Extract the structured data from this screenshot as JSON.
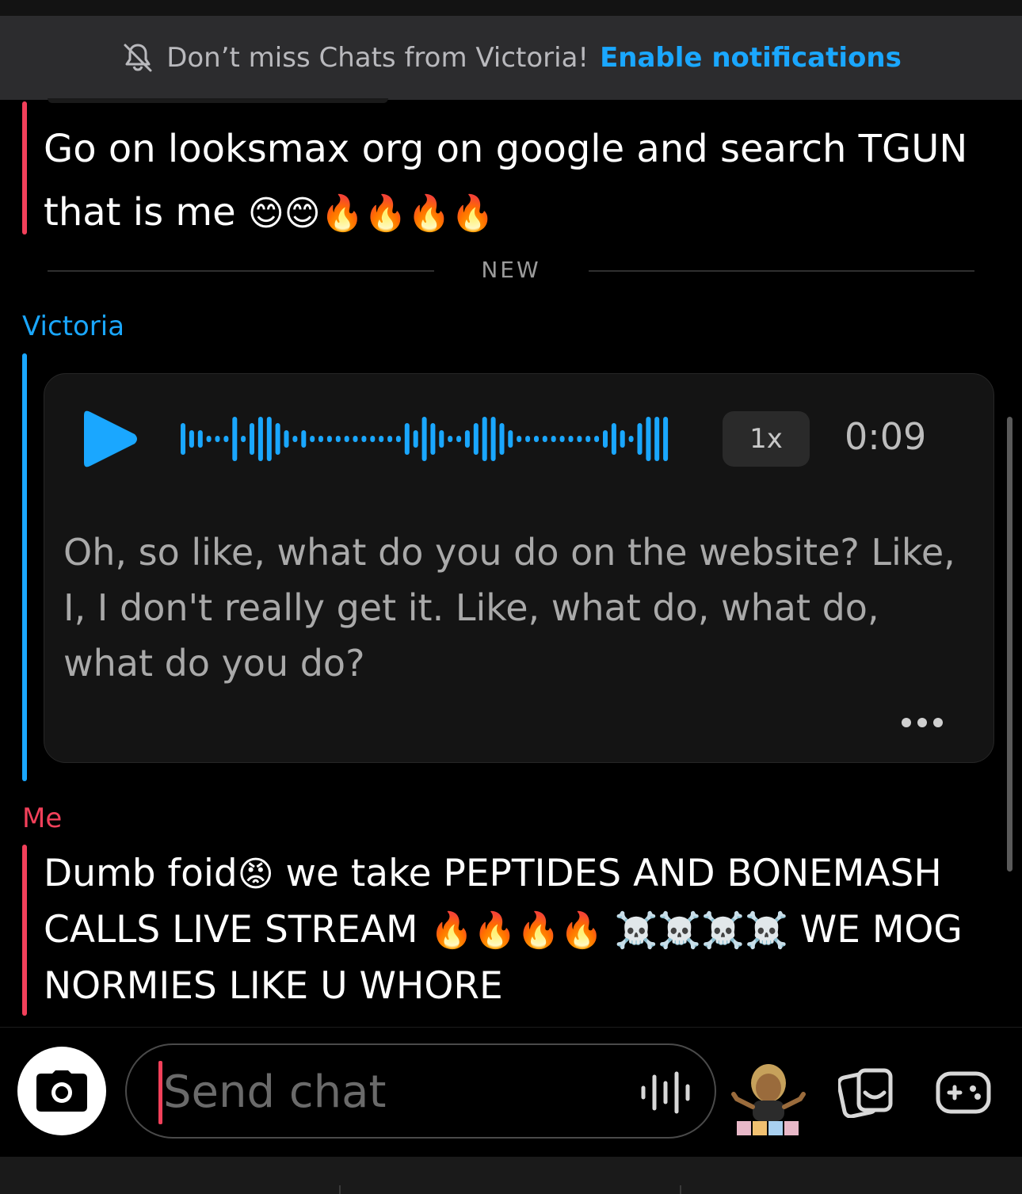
{
  "banner": {
    "text": "Don’t miss Chats from Victoria!",
    "link": "Enable notifications"
  },
  "messages": {
    "first": {
      "line1": "Go on looksmax org on google and search TGUN",
      "line2": "that is me ",
      "emojis": "😊😊🔥🔥🔥🔥"
    },
    "divider_label": "NEW",
    "victoria": {
      "sender": "Victoria",
      "voice": {
        "speed": "1x",
        "duration": "0:09",
        "transcript": "Oh, so like, what do you do on the website? Like, I, I don't really get it. Like, what do, what do, what do you do?"
      }
    },
    "me": {
      "sender": "Me",
      "part1": "Dumb foid",
      "emoji1": "😡",
      "part2": " we take PEPTIDES AND BONEMASH CALLS LIVE STREAM ",
      "emoji2": "🔥🔥🔥🔥 ☠️☠️☠️☠️",
      "part3": " WE MOG NORMIES LIKE U WHORE"
    }
  },
  "composer": {
    "placeholder": "Send chat"
  },
  "colors": {
    "accent_blue": "#1aa7ff",
    "accent_red": "#f2405a"
  },
  "icons": [
    "bell-off-icon",
    "play-icon",
    "waveform-icon",
    "more-icon",
    "camera-icon",
    "microphone-icon",
    "bitmoji-avatar",
    "stickers-icon",
    "games-icon"
  ]
}
